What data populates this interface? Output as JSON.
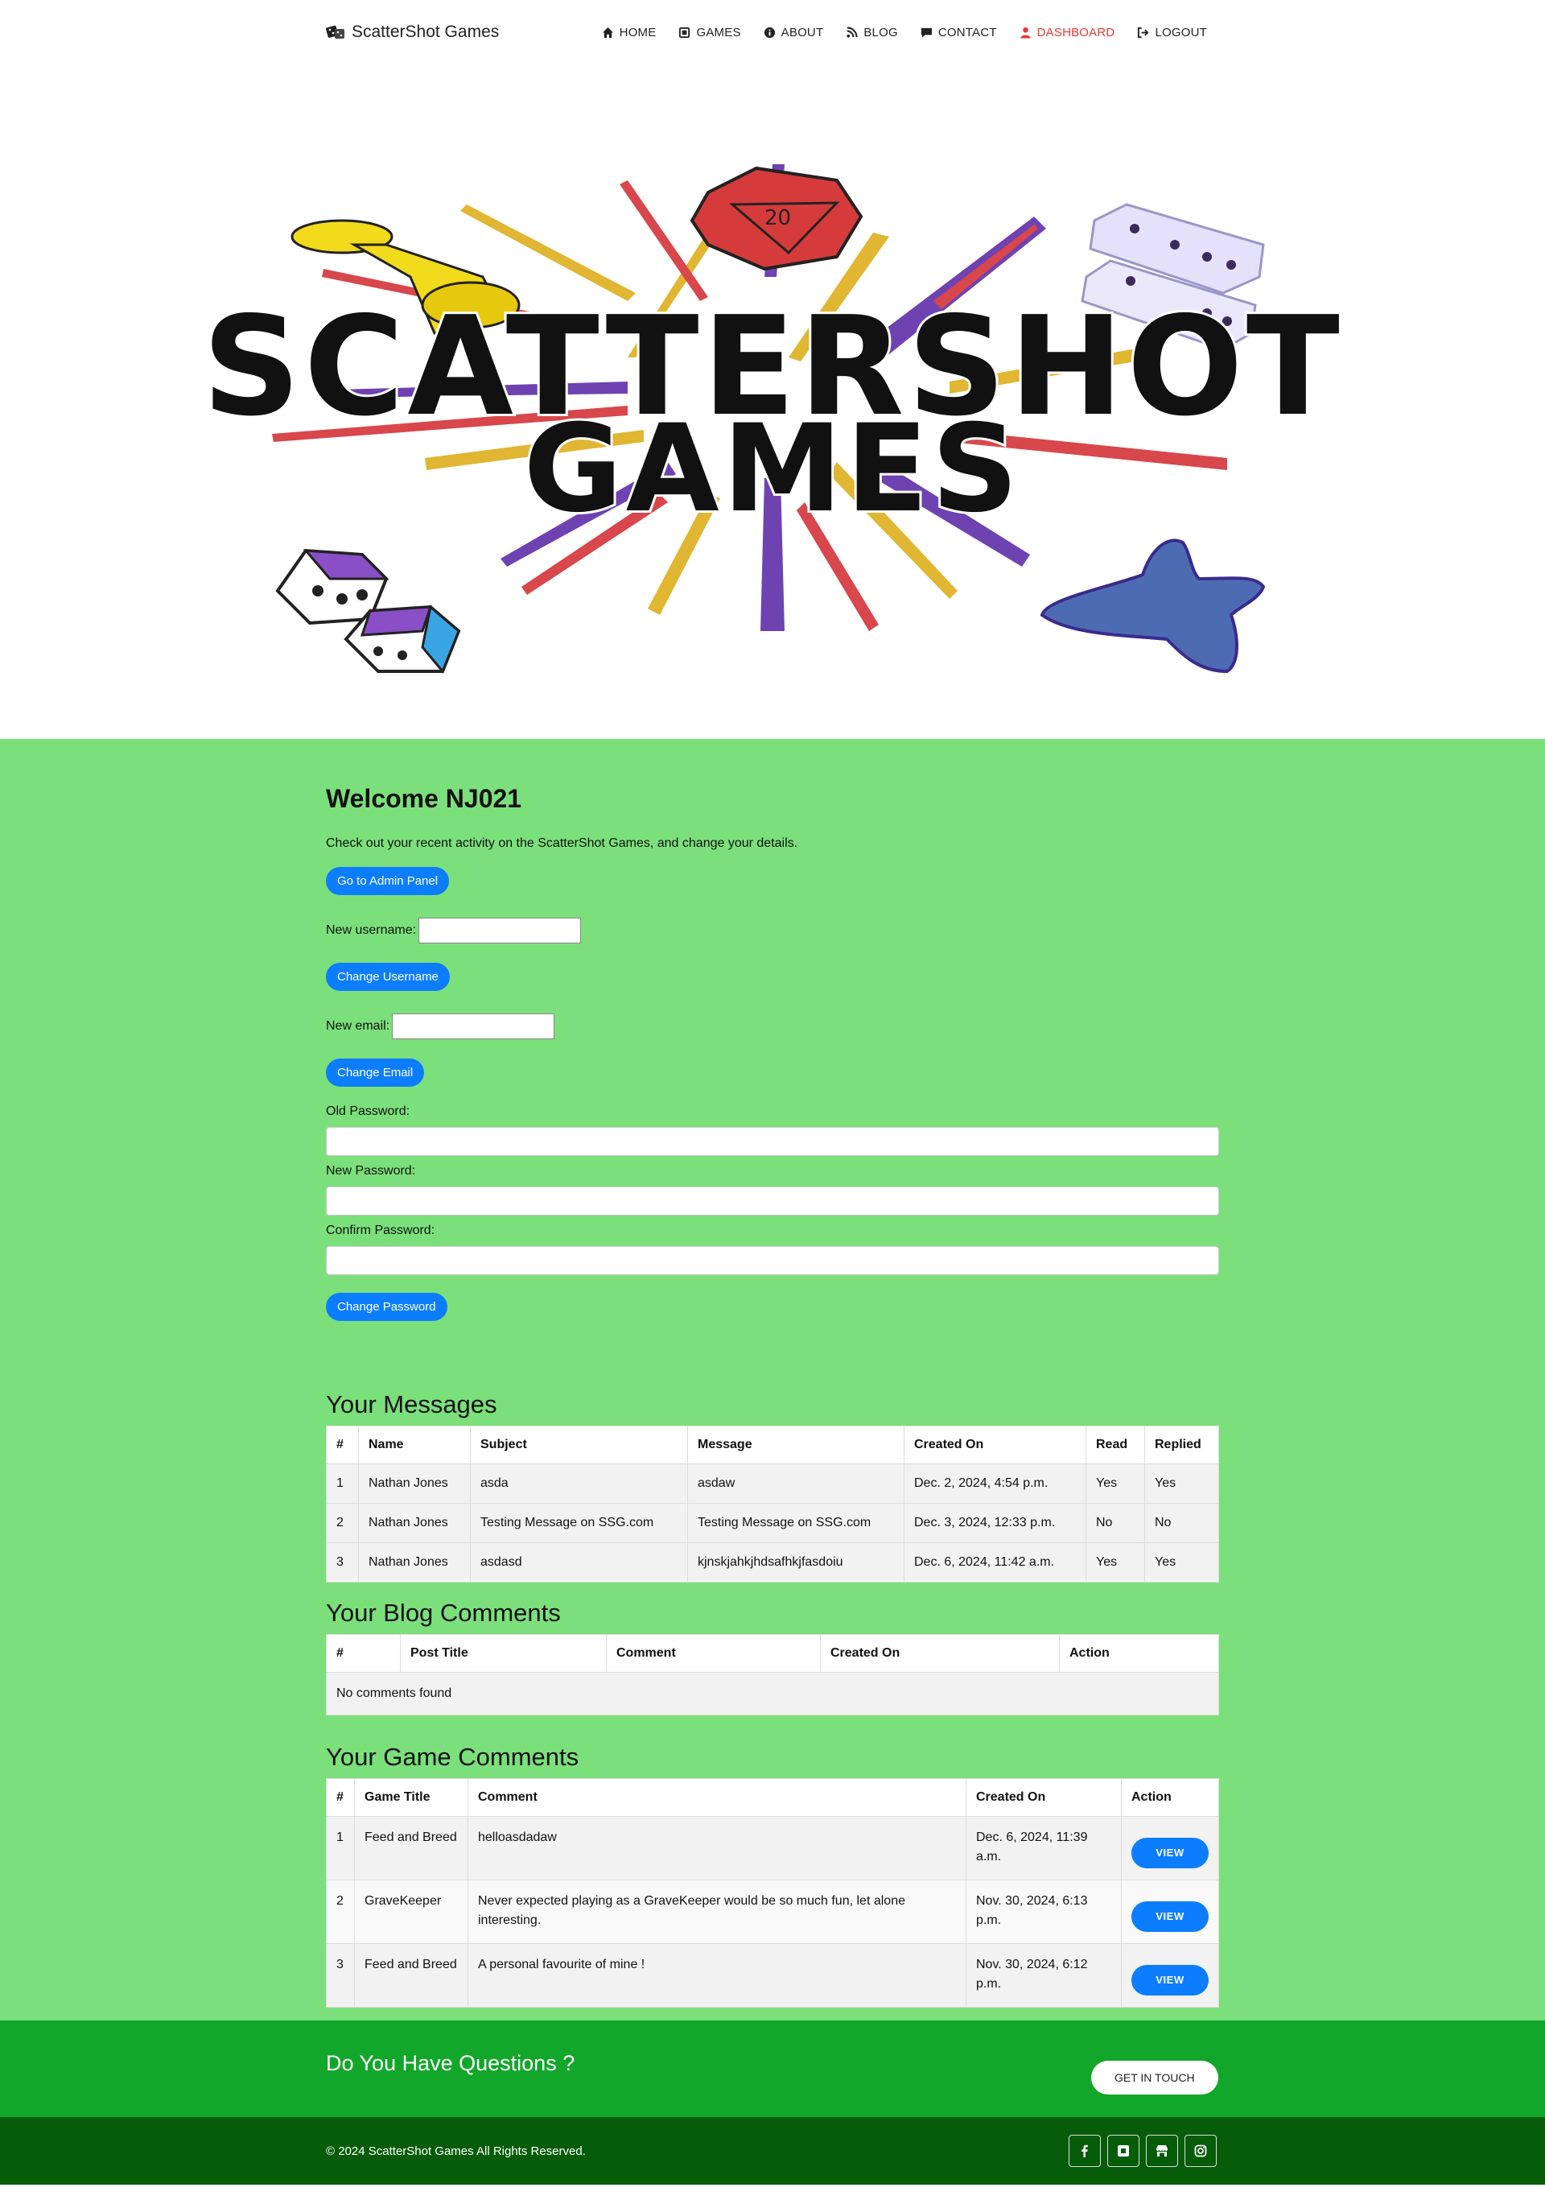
{
  "brand": {
    "name": "ScatterShot Games",
    "icon": "dice-icon"
  },
  "nav": {
    "items": [
      {
        "label": "HOME",
        "icon": "home-icon"
      },
      {
        "label": "GAMES",
        "icon": "games-icon"
      },
      {
        "label": "ABOUT",
        "icon": "info-icon"
      },
      {
        "label": "BLOG",
        "icon": "blog-icon"
      },
      {
        "label": "CONTACT",
        "icon": "chat-icon"
      },
      {
        "label": "DASHBOARD",
        "icon": "user-icon",
        "active": true
      },
      {
        "label": "LOGOUT",
        "icon": "logout-icon"
      }
    ],
    "active_color": "#e53935"
  },
  "hero": {
    "logo_line1": "SCATTERSHOT",
    "logo_line2": "GAMES"
  },
  "dashboard": {
    "title": "Welcome NJ021",
    "intro": "Check out your recent activity on the ScatterShot Games, and change your details.",
    "admin_button": "Go to Admin Panel",
    "username_label": "New username:",
    "username_value": "",
    "username_button": "Change Username",
    "email_label": "New email:",
    "email_value": "",
    "email_button": "Change Email",
    "old_password_label": "Old Password:",
    "new_password_label": "New Password:",
    "confirm_password_label": "Confirm Password:",
    "password_button": "Change Password"
  },
  "messages": {
    "title": "Your Messages",
    "columns": [
      "#",
      "Name",
      "Subject",
      "Message",
      "Created On",
      "Read",
      "Replied"
    ],
    "rows": [
      [
        "1",
        "Nathan Jones",
        "asda",
        "asdaw",
        "Dec. 2, 2024, 4:54 p.m.",
        "Yes",
        "Yes"
      ],
      [
        "2",
        "Nathan Jones",
        "Testing Message on SSG.com",
        "Testing Message on SSG.com",
        "Dec. 3, 2024, 12:33 p.m.",
        "No",
        "No"
      ],
      [
        "3",
        "Nathan Jones",
        "asdasd",
        "kjnskjahkjhdsafhkjfasdoiu",
        "Dec. 6, 2024, 11:42 a.m.",
        "Yes",
        "Yes"
      ]
    ]
  },
  "blog_comments": {
    "title": "Your Blog Comments",
    "columns": [
      "#",
      "Post Title",
      "Comment",
      "Created On",
      "Action"
    ],
    "empty_text": "No comments found"
  },
  "game_comments": {
    "title": "Your Game Comments",
    "columns": [
      "#",
      "Game Title",
      "Comment",
      "Created On",
      "Action"
    ],
    "rows": [
      {
        "num": "1",
        "game": "Feed and Breed",
        "comment": "helloasdadaw",
        "created": "Dec. 6, 2024, 11:39 a.m.",
        "action": "VIEW"
      },
      {
        "num": "2",
        "game": "GraveKeeper",
        "comment": "Never expected playing as a GraveKeeper would be so much fun, let alone interesting.",
        "created": "Nov. 30, 2024, 6:13 p.m.",
        "action": "VIEW"
      },
      {
        "num": "3",
        "game": "Feed and Breed",
        "comment": "A personal favourite of mine !",
        "created": "Nov. 30, 2024, 6:12 p.m.",
        "action": "VIEW"
      }
    ]
  },
  "cta": {
    "question": "Do You Have Questions ?",
    "button": "GET IN TOUCH"
  },
  "footer": {
    "copyright": "© 2024 ScatterShot Games All Rights Reserved.",
    "socials": [
      "facebook-icon",
      "square-icon",
      "store-icon",
      "instagram-icon"
    ]
  },
  "colors": {
    "main_bg": "#7be07b",
    "button_blue": "#0d7dff",
    "cta_green": "#12a62a",
    "footer_green": "#075c0a"
  }
}
